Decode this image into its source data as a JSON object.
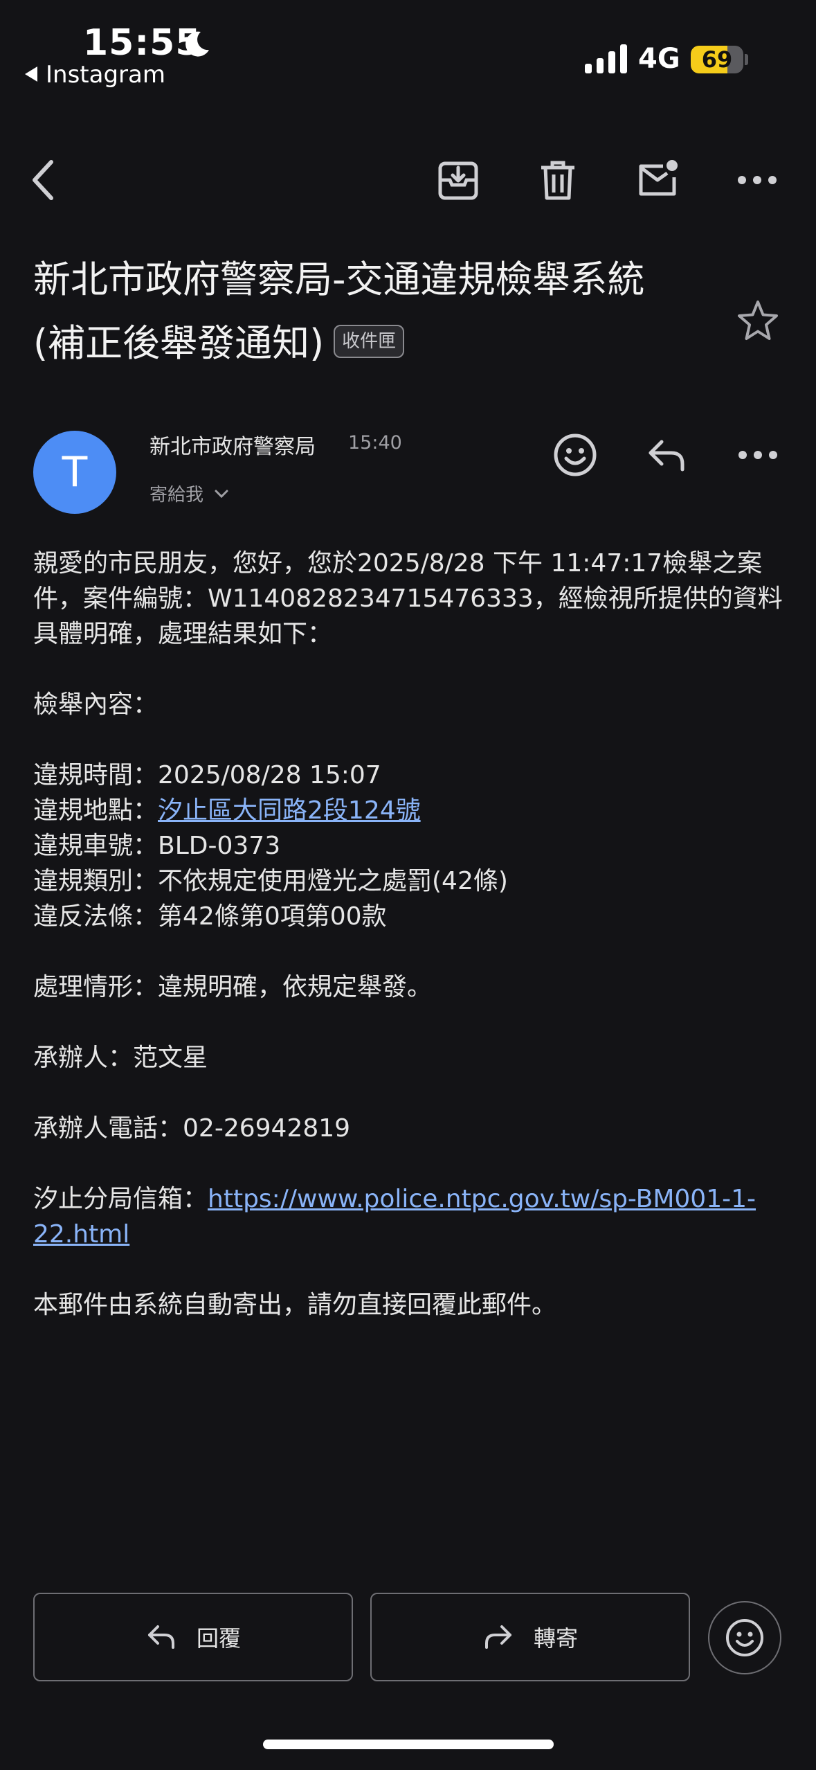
{
  "status_bar": {
    "time": "15:55",
    "back_app": "Instagram",
    "network": "4G",
    "battery": "69",
    "battery_level": 0.69
  },
  "toolbar": {
    "back_icon": "chevron-left-icon",
    "archive_icon": "archive-icon",
    "delete_icon": "trash-icon",
    "mark_unread_icon": "mail-unread-icon",
    "more_icon": "more-horizontal-icon"
  },
  "email": {
    "subject_line1": "新北市政府警察局-交通違規檢舉系統",
    "subject_line2": "(補正後舉發通知)",
    "label": "收件匣",
    "sender": {
      "avatar_letter": "T",
      "avatar_color": "#4d8df5",
      "name": "新北市政府警察局",
      "time": "15:40",
      "recipient": "寄給我"
    },
    "body": {
      "intro": "親愛的市民朋友，您好，您於2025/8/28 下午 11:47:17檢舉之案件，案件編號：W1140828234715476333，經檢視所提供的資料具體明確，處理結果如下：",
      "content_heading": "檢舉內容：",
      "time_label": "違規時間：",
      "time_value": "2025/08/28 15:07",
      "location_label": "違規地點：",
      "location_value": "汐止區大同路2段124號",
      "plate_label": "違規車號：",
      "plate_value": "BLD-0373",
      "category_label": "違規類別：",
      "category_value": "不依規定使用燈光之處罰(42條)",
      "law_label": "違反法條：",
      "law_value": "第42條第0項第00款",
      "status_label": "處理情形：",
      "status_value": "違規明確，依規定舉發。",
      "handler_label": "承辦人：",
      "handler_value": "范文星",
      "phone_label": "承辦人電話：",
      "phone_value": "02-26942819",
      "mailbox_label": "汐止分局信箱：",
      "mailbox_link_line1": "https://www.police.ntpc.gov.tw/sp-BM001-1-",
      "mailbox_link_line2": "22.html",
      "footer": "本郵件由系統自動寄出，請勿直接回覆此郵件。"
    }
  },
  "actions": {
    "reply_label": "回覆",
    "forward_label": "轉寄"
  },
  "colors": {
    "background": "#131316",
    "link": "#8ab4f8",
    "battery": "#f5cc1a"
  }
}
